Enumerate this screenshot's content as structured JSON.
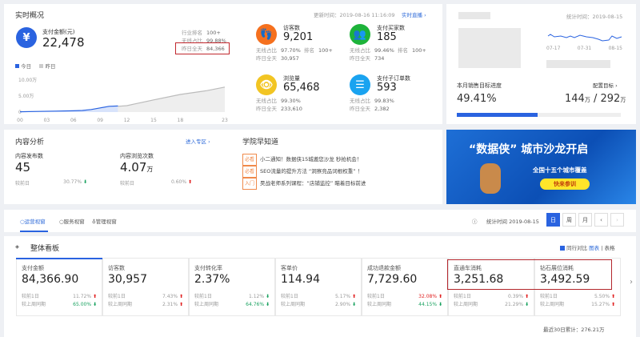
{
  "realtime": {
    "title": "实时概况",
    "update_time": "更新时间：2019-08-16 11:16:09",
    "live_link": "实时直播",
    "pay": {
      "label": "支付金额(元)",
      "value": "22,478",
      "rank_label": "行业排名",
      "rank": "100+",
      "wireless_label": "无线占比",
      "wireless": "99.88%",
      "yesterday_label": "昨日全天",
      "yesterday": "84,366"
    },
    "legend": {
      "today": "今日",
      "yesterday": "昨日"
    },
    "chart_data": {
      "type": "area",
      "title": "",
      "xlabel": "",
      "ylabel": "",
      "ylim": [
        0,
        100000
      ],
      "y_ticks": [
        "10.00万",
        "5.00万",
        "0"
      ],
      "x_ticks": [
        "00",
        "03",
        "06",
        "09",
        "12",
        "15",
        "18",
        "23"
      ],
      "series": [
        {
          "name": "今日",
          "x": [
            0,
            2,
            4,
            6,
            7,
            8,
            9,
            10,
            11
          ],
          "values": [
            1000,
            2000,
            3000,
            4000,
            5000,
            8000,
            13000,
            18000,
            19000
          ]
        },
        {
          "name": "昨日",
          "x": [
            11,
            12,
            13,
            15,
            18,
            21,
            23
          ],
          "values": [
            18000,
            20000,
            26000,
            38000,
            55000,
            67000,
            78000
          ]
        }
      ]
    },
    "stats": [
      {
        "label": "访客数",
        "value": "9,201",
        "wireless": "97.70%",
        "rank_label": "排名",
        "rank": "100+",
        "yesterday": "30,957",
        "icon": "footprint-icon",
        "color": "#f5701e"
      },
      {
        "label": "支付买家数",
        "value": "185",
        "wireless": "99.46%",
        "rank_label": "排名",
        "rank": "100+",
        "yesterday": "734",
        "icon": "buyers-icon",
        "color": "#1db33a"
      },
      {
        "label": "浏览量",
        "value": "65,468",
        "wireless": "99.30%",
        "yesterday": "233,610",
        "icon": "eye-icon",
        "color": "#f2c523"
      },
      {
        "label": "支付子订单数",
        "value": "593",
        "wireless": "99.83%",
        "yesterday": "2,382",
        "icon": "order-icon",
        "color": "#1aa3f0"
      }
    ],
    "wireless_label": "无线占比",
    "yesterday_label": "昨日全天"
  },
  "side": {
    "stat_time": "统计时间：2019-08-15",
    "x_ticks": [
      "07-17",
      "07-31",
      "08-15"
    ],
    "target_label": "本月销售目标进度",
    "config_link": "配置目标",
    "progress": "49.41%",
    "progress_value": 49.41,
    "done": "144",
    "total": "292",
    "unit": "万",
    "sep": "/"
  },
  "content": {
    "title": "内容分析",
    "link": "进入专区",
    "items": [
      {
        "label": "内容发布数",
        "value": "45",
        "unit": "",
        "cmp_label": "较前日",
        "cmp": "30.77%",
        "dir": "down"
      },
      {
        "label": "内容浏览次数",
        "value": "4.07",
        "unit": "万",
        "cmp_label": "较前日",
        "cmp": "0.60%",
        "dir": "up"
      }
    ]
  },
  "academy": {
    "title": "学院早知道",
    "news": [
      {
        "tag": "必看",
        "text": "小二通知！数据侠15城邀您沙龙 秒抢机会！"
      },
      {
        "tag": "必看",
        "text": "SEO流量的提升方法 “洞察竞品词根权重” ！"
      },
      {
        "tag": "入门",
        "text": "昊战老师系列课程：“店铺监控” 瞄着目标前进"
      }
    ]
  },
  "banner": {
    "headline": "“数据侠” 城市沙龙开启",
    "sub": "全国十五个城市覆盖",
    "cta": "快来参训"
  },
  "tabs": {
    "items": [
      "运营视窗",
      "服务视窗",
      "管理视窗"
    ],
    "stat_time": "统计时间 2019-08-15",
    "periods": [
      "日",
      "周",
      "月"
    ]
  },
  "board": {
    "title": "整体看板",
    "compare_label": "同行对比",
    "chart_link": "图表",
    "table_link": "表格",
    "total": "最近30日累计：276.21万",
    "day_label": "较前1日",
    "week_label": "较上周同期",
    "metrics": [
      {
        "label": "支付金额",
        "value": "84,366.90",
        "day": "11.72%",
        "day_dir": "up",
        "week": "65.00%",
        "week_dir": "down",
        "week_color": "green"
      },
      {
        "label": "访客数",
        "value": "30,957",
        "day": "7.43%",
        "day_dir": "up",
        "week": "2.31%",
        "week_dir": "up"
      },
      {
        "label": "支付转化率",
        "value": "2.37%",
        "day": "1.12%",
        "day_dir": "down",
        "week": "64.76%",
        "week_dir": "down",
        "week_color": "green"
      },
      {
        "label": "客单价",
        "value": "114.94",
        "day": "5.17%",
        "day_dir": "up",
        "week": "2.90%",
        "week_dir": "down"
      },
      {
        "label": "成功退款金额",
        "value": "7,729.60",
        "day": "32.08%",
        "day_dir": "up",
        "day_color": "red",
        "week": "44.15%",
        "week_dir": "down",
        "week_color": "green"
      },
      {
        "label": "直通车消耗",
        "value": "3,251.68",
        "day": "0.39%",
        "day_dir": "up",
        "week": "21.29%",
        "week_dir": "down"
      },
      {
        "label": "钻石展位消耗",
        "value": "3,492.59",
        "day": "5.50%",
        "day_dir": "up",
        "week": "15.27%",
        "week_dir": "up"
      }
    ]
  }
}
